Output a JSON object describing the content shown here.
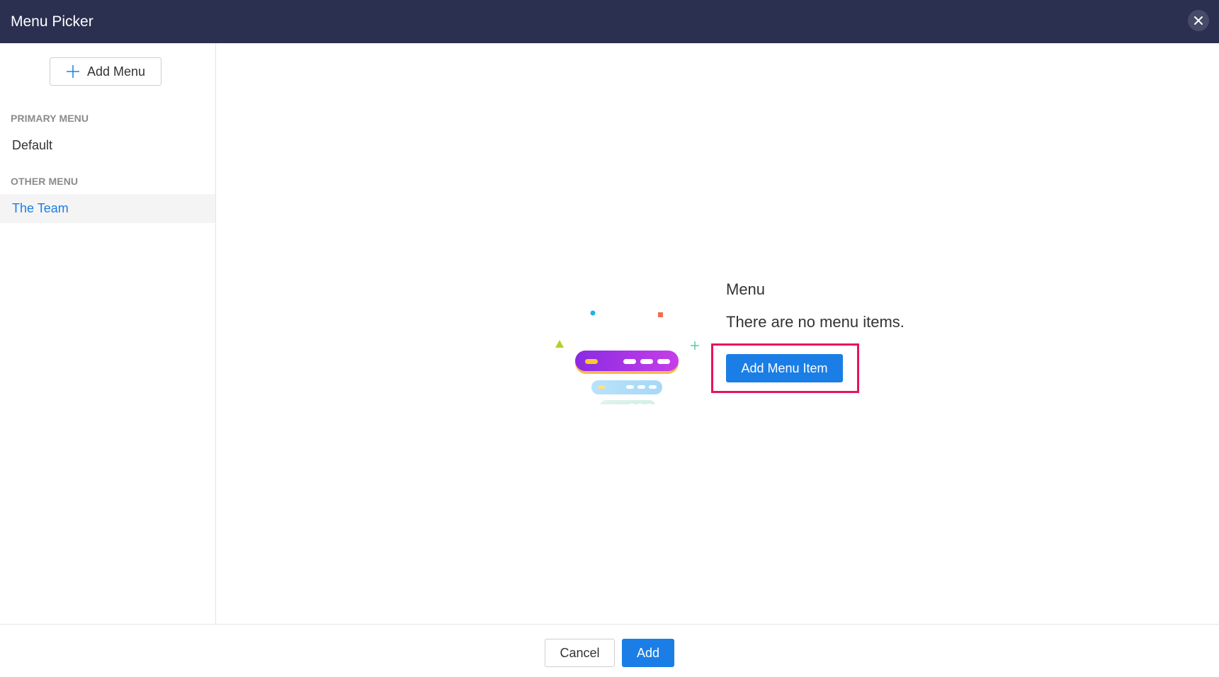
{
  "window": {
    "title": "Menu Picker"
  },
  "sidebar": {
    "add_menu_label": "Add Menu",
    "primary_section_label": "PRIMARY MENU",
    "primary_items": [
      {
        "label": "Default",
        "active": false
      }
    ],
    "other_section_label": "OTHER MENU",
    "other_items": [
      {
        "label": "The Team",
        "active": true
      }
    ]
  },
  "main": {
    "empty_title": "Menu",
    "empty_description": "There are no menu items.",
    "add_menu_item_label": "Add Menu Item"
  },
  "footer": {
    "cancel_label": "Cancel",
    "add_label": "Add"
  },
  "colors": {
    "header_bg": "#2b3050",
    "accent": "#1a7ee6",
    "highlight": "#e8135a",
    "active_item_bg": "#f4f4f4"
  },
  "icons": {
    "close": "close-icon",
    "add": "plus-icon",
    "illustration": "menu-illustration-icon"
  }
}
